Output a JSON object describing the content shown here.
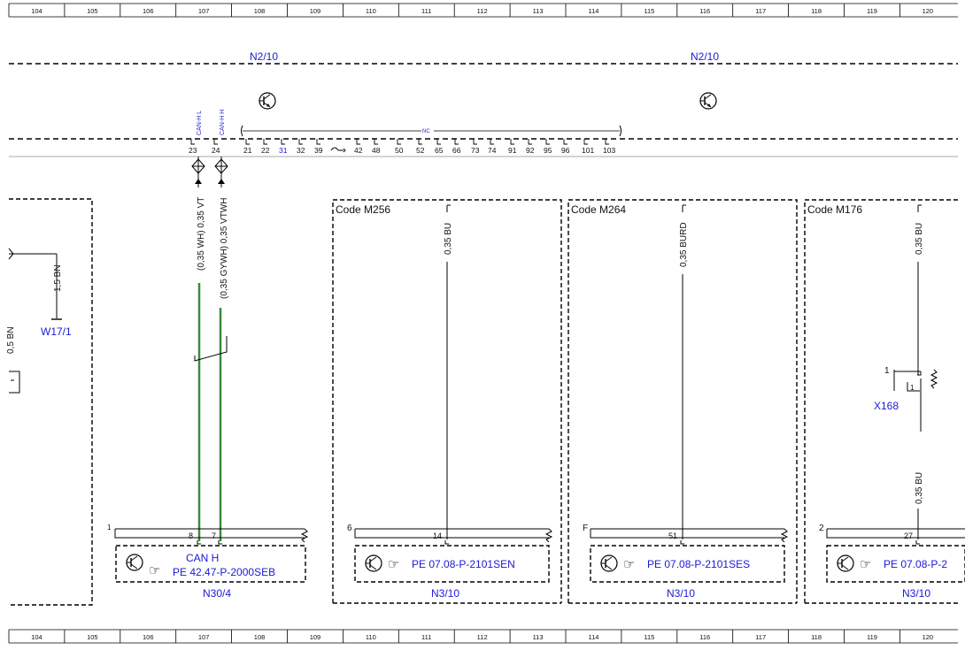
{
  "grid": [
    "104",
    "105",
    "106",
    "107",
    "108",
    "109",
    "110",
    "111",
    "112",
    "113",
    "114",
    "115",
    "116",
    "117",
    "118",
    "119",
    "120"
  ],
  "top": {
    "module_label_left": "N2/10",
    "module_label_right": "N2/10",
    "can_l_label": "CAN-H L",
    "can_h_label": "CAN-H H",
    "nc_label": "NC",
    "pins": [
      "23",
      "24",
      "21",
      "22",
      "31",
      "32",
      "39",
      "42",
      "48",
      "50",
      "52",
      "65",
      "66",
      "73",
      "74",
      "91",
      "92",
      "95",
      "96",
      "101",
      "103"
    ],
    "pin_31_color": "#1a1ad6"
  },
  "left": {
    "wire_label": "1,5 BN",
    "ground_label": "W17/1",
    "partial_wire_label": "0,5 BN"
  },
  "can_wires": {
    "wire_l": "(0,35 WH) 0,35 VT",
    "wire_h": "(0,35 GYWH) 0,35 VTWH",
    "color": "#3d8a3d"
  },
  "n30": {
    "section_number": "1",
    "pin_left": "8",
    "pin_right": "7",
    "text1": "CAN H",
    "text2": "PE 42.47-P-2000SEB",
    "name": "N30/4"
  },
  "sections": [
    {
      "code": "Code M256",
      "wire": "0,35 BU",
      "pin": "14",
      "section_number": "6",
      "ref": "PE 07.08-P-2101SEN",
      "name": "N3/10"
    },
    {
      "code": "Code M264",
      "wire": "0,35 BURD",
      "pin": "51",
      "section_number": "F",
      "ref": "PE 07.08-P-2101SES",
      "name": "N3/10"
    },
    {
      "code": "Code M176",
      "wire": "0,35 BU",
      "wire2": "0,35 BU",
      "pin": "27",
      "section_number": "2",
      "ref": "PE 07.08-P-2",
      "name": "N3/10",
      "connector": {
        "name": "X168",
        "pin_outer": "1",
        "pin_inner": "1"
      }
    }
  ]
}
